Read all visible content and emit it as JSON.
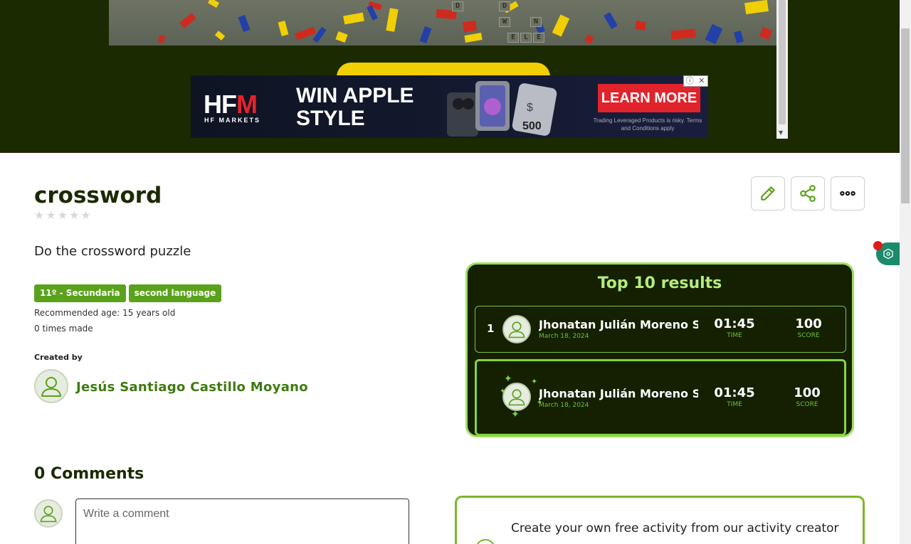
{
  "ad": {
    "brand": "HFM",
    "brand_sub": "HF MARKETS",
    "headline_line1": "WIN APPLE",
    "headline_line2": "STYLE",
    "voucher": "500",
    "cta": "LEARN MORE",
    "disclaimer": "Trading Leveraged Products is risky. Terms and Conditions apply",
    "info_icon": "info-icon",
    "close_icon": "close-icon",
    "brand_color": "#e1232b"
  },
  "game": {
    "tiles": [
      "D",
      "D",
      "W",
      "N",
      "E",
      "L",
      "E"
    ]
  },
  "activity": {
    "title": "crossword",
    "rating_stars": [
      "★",
      "★",
      "★",
      "★",
      "★"
    ],
    "description": "Do the crossword puzzle",
    "tags": [
      "11º - Secundaria",
      "second language"
    ],
    "recommended_age": "Recommended age: 15 years old",
    "times_made": "0 times made",
    "created_by_label": "Created by",
    "author": "Jesús Santiago Castillo Moyano"
  },
  "actions": {
    "edit_icon": "pencil-icon",
    "share_icon": "share-icon",
    "more_icon": "more-icon"
  },
  "leaderboard": {
    "title": "Top 10 results",
    "time_label": "TIME",
    "score_label": "SCORE",
    "rows": [
      {
        "rank": "1",
        "name": "Jhonatan Julián Moreno Suárez",
        "date": "March 18, 2024",
        "time": "01:45",
        "score": "100"
      }
    ],
    "current_user": {
      "name": "Jhonatan Julián Moreno Suárez",
      "date": "March 18, 2024",
      "time": "01:45",
      "score": "100"
    }
  },
  "comments": {
    "title": "0 Comments",
    "placeholder": "Write a comment"
  },
  "promo": {
    "text": "Create your own free activity from our activity creator"
  },
  "colors": {
    "accent_green": "#5aa21b",
    "dark_bg": "#142000",
    "board_border": "#9ede5e"
  }
}
